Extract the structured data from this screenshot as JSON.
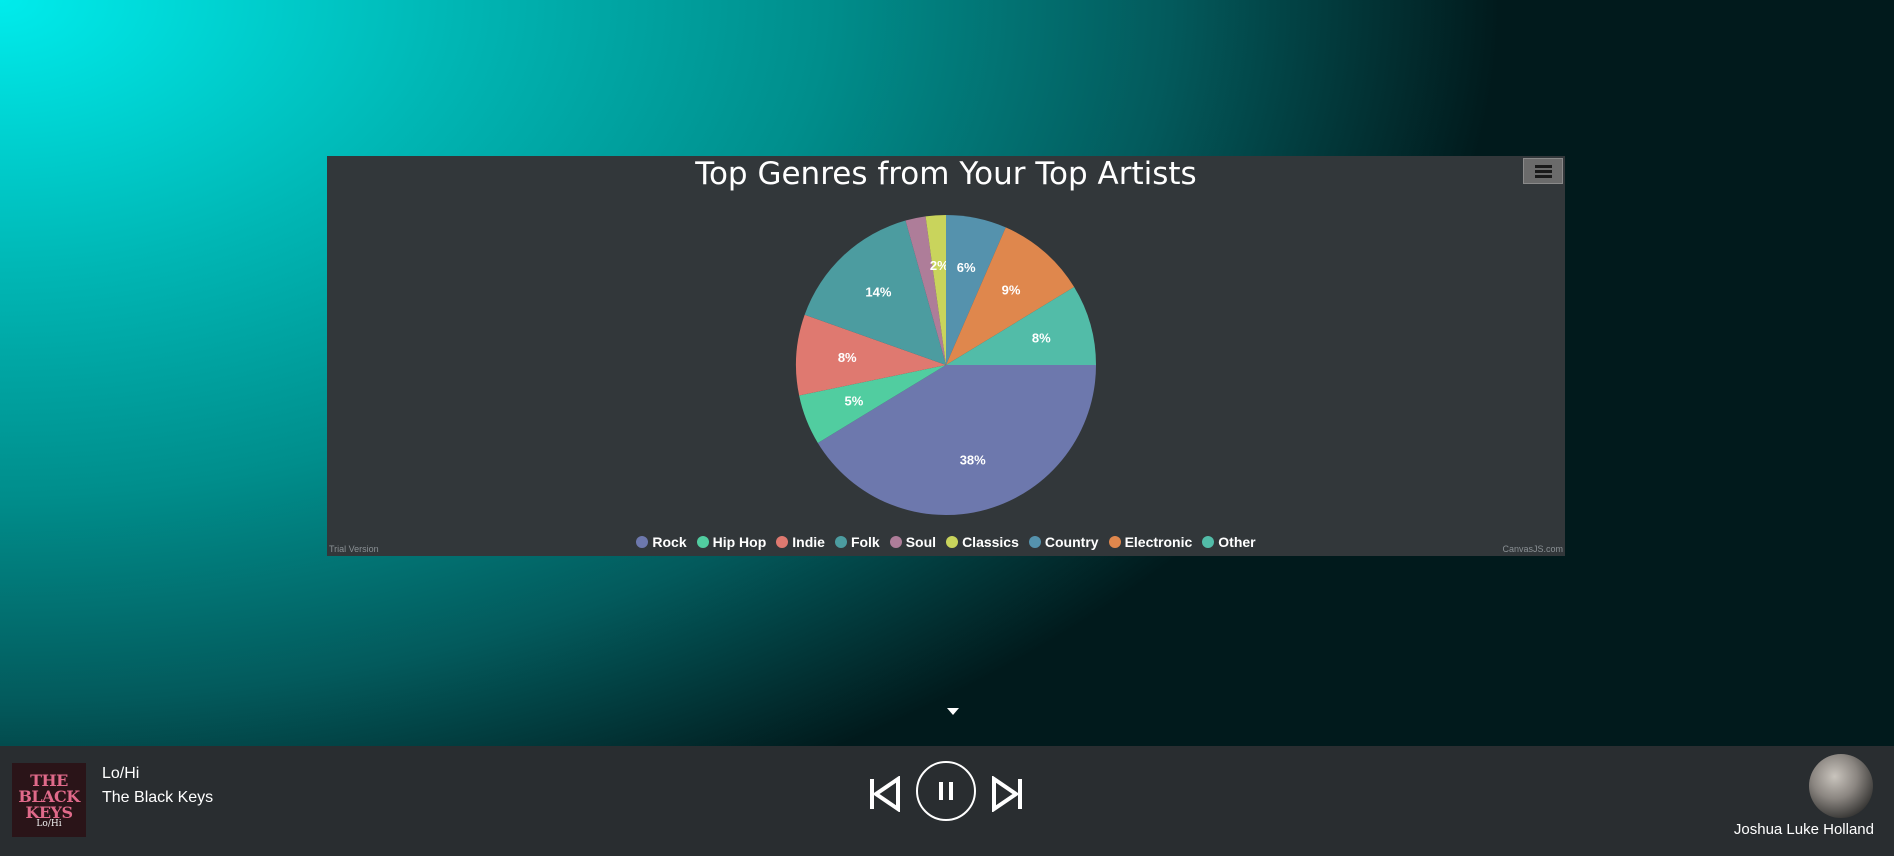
{
  "chart_data": {
    "type": "pie",
    "title": "Top Genres from Your Top Artists",
    "categories": [
      "Rock",
      "Hip Hop",
      "Indie",
      "Folk",
      "Soul",
      "Classics",
      "Country",
      "Electronic",
      "Other"
    ],
    "values": [
      38,
      5,
      8,
      14,
      2,
      2,
      6,
      9,
      8
    ],
    "labels": [
      "38%",
      "5%",
      "8%",
      "14%",
      "",
      "2%",
      "6%",
      "9%",
      "8%"
    ],
    "colors": [
      "#6d78ad",
      "#51cda0",
      "#df7970",
      "#4c9ca0",
      "#ae7d99",
      "#c9d45c",
      "#5592ad",
      "#df874d",
      "#52bca8"
    ],
    "legend": "bottom"
  },
  "chart": {
    "menu_icon": "hamburger-icon",
    "trial_text": "Trial Version",
    "credit_text": "CanvasJS.com"
  },
  "player": {
    "album_art_text": "THE BLACK KEYS",
    "album_art_sub": "Lo/Hi",
    "track_title": "Lo/Hi",
    "track_artist": "The Black Keys",
    "controls": [
      "previous-icon",
      "pause-icon",
      "next-icon"
    ],
    "user_name": "Joshua Luke Holland"
  },
  "page": {
    "scroll_icon": "caret-down-icon"
  }
}
